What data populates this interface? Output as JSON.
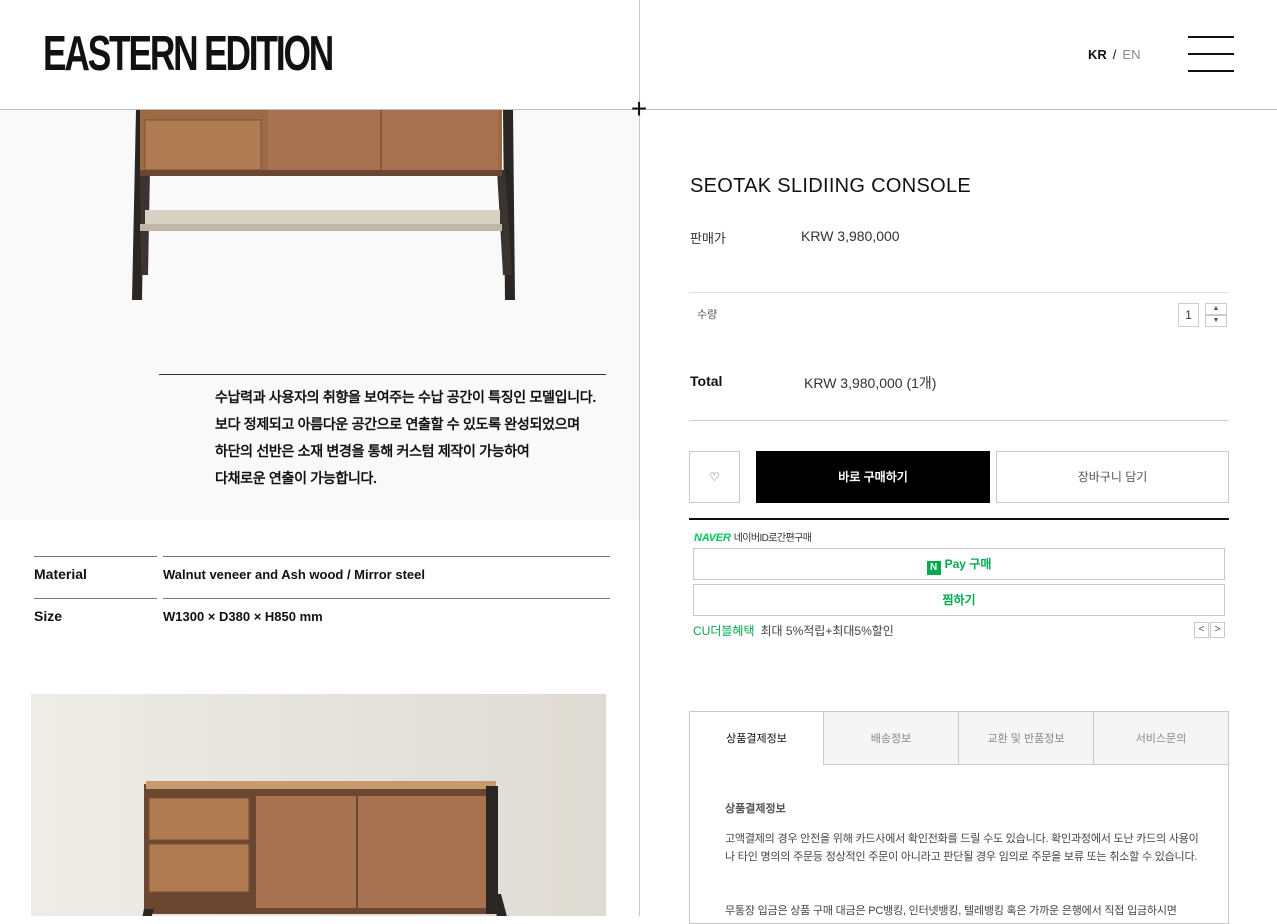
{
  "header": {
    "logo": "EASTERN EDITION",
    "lang_kr": "KR",
    "lang_sep": "/",
    "lang_en": "EN"
  },
  "left": {
    "description": [
      "수납력과 사용자의 취향을 보여주는 수납 공간이 특징인 모델입니다.",
      "보다 정제되고 아름다운 공간으로 연출할 수 있도록 완성되었으며",
      "하단의 선반은 소재 변경을 통해 커스텀 제작이 가능하여",
      "다채로운 연출이 가능합니다."
    ],
    "specs": [
      {
        "label": "Material",
        "value": "Walnut veneer and Ash wood / Mirror steel"
      },
      {
        "label": "Size",
        "value": "W1300 × D380 × H850 mm"
      }
    ]
  },
  "product": {
    "title": "SEOTAK SLIDIING CONSOLE",
    "price_label": "판매가",
    "price": "KRW 3,980,000",
    "qty_label": "수량",
    "qty": "1",
    "qty_up": "▲",
    "qty_down": "▼",
    "total_label": "Total",
    "total": "KRW 3,980,000 (1개)",
    "wish_icon": "♡",
    "buy_label": "바로 구매하기",
    "cart_label": "장바구니 담기"
  },
  "naver": {
    "brand": "NAVER",
    "tagline": "네이버ID로간편구매",
    "pay_badge": "N",
    "pay_label": "Pay 구매",
    "jjim_label": "찜하기",
    "cu_label": "CU더블혜택",
    "cu_text": "최대 5%적립+최대5%할인",
    "prev": "<",
    "next": ">"
  },
  "tabs": [
    {
      "label": "상품결제정보"
    },
    {
      "label": "배송정보"
    },
    {
      "label": "교환 및 반품정보"
    },
    {
      "label": "서비스문의"
    }
  ],
  "tab_content": {
    "heading": "상품결제정보",
    "p1": "고액결제의 경우 안전을 위해 카드사에서 확인전화를 드릴 수도 있습니다. 확인과정에서 도난 카드의 사용이나 타인 명의의 주문등 정상적인 주문이 아니라고 판단될 경우 임의로 주문을 보류 또는 취소할 수 있습니다.",
    "p2": "무통장 입금은 상품 구매 대금은 PC뱅킹, 인터넷뱅킹, 텔레뱅킹 혹은 가까운 은행에서 직접 입금하시면"
  },
  "colors": {
    "accent": "#000000",
    "naver_green": "#03c75a"
  }
}
